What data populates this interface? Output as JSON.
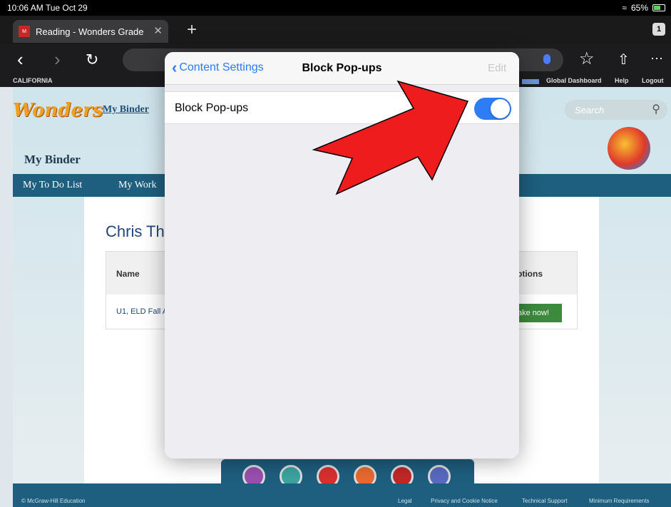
{
  "status_bar": {
    "time": "10:06 AM  Tue Oct 29",
    "battery": "65%"
  },
  "tab_bar": {
    "tab_title": "Reading - Wonders Grade",
    "tab_count": "1"
  },
  "bookmarks": {
    "left": "CALIFORNIA",
    "items": [
      "Global Dashboard",
      "Help",
      "Logout"
    ]
  },
  "page": {
    "logo": "Wonders",
    "my_binder_link": "My Binder",
    "search_placeholder": "Search",
    "binder_title": "My Binder",
    "nav": [
      "My To Do List",
      "My Work"
    ],
    "student_name": "Chris Th",
    "table": {
      "col_name": "Name",
      "col_options": "ptions",
      "row1_name": "U1, ELD Fall A",
      "take_now": "ake now!"
    },
    "footer": {
      "copyright": "© McGraw-Hill Education",
      "links": [
        "Legal",
        "Privacy and Cookie Notice",
        "Technical Support",
        "Minimum Requirements"
      ]
    }
  },
  "modal": {
    "back_label": "Content Settings",
    "title": "Block Pop-ups",
    "edit_label": "Edit",
    "setting_label": "Block Pop-ups",
    "toggle_state": "on"
  },
  "colors": {
    "accent": "#2e7cf6",
    "arrow": "#ee1c1c",
    "nav": "#1e5e7e"
  }
}
